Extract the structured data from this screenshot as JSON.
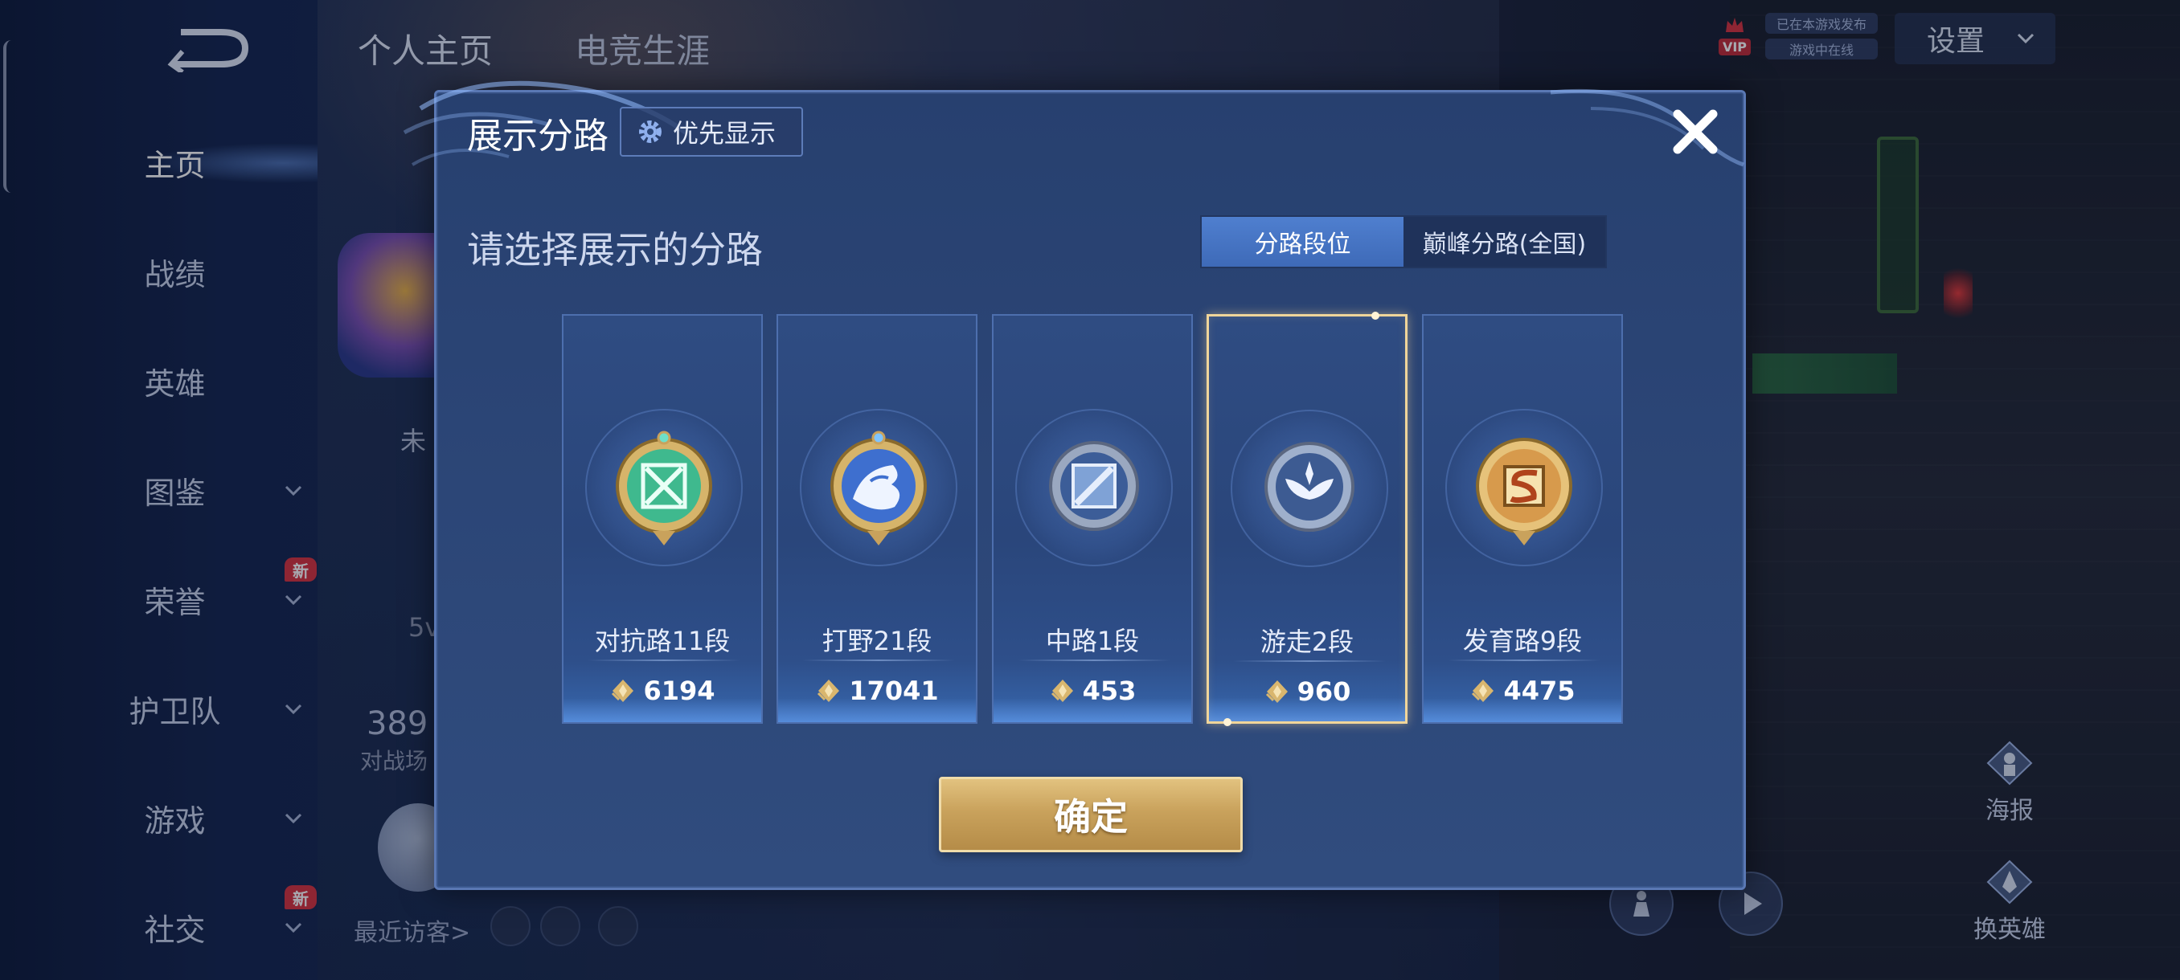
{
  "background": {
    "tabs": [
      "个人主页",
      "电竞生涯"
    ],
    "nav": [
      {
        "label": "主页",
        "active": true,
        "chevron": false,
        "new": false
      },
      {
        "label": "战绩",
        "active": false,
        "chevron": false,
        "new": false
      },
      {
        "label": "英雄",
        "active": false,
        "chevron": false,
        "new": false
      },
      {
        "label": "图鉴",
        "active": false,
        "chevron": true,
        "new": false
      },
      {
        "label": "荣誉",
        "active": false,
        "chevron": true,
        "new": true
      },
      {
        "label": "护卫队",
        "active": false,
        "chevron": true,
        "new": false
      },
      {
        "label": "游戏",
        "active": false,
        "chevron": true,
        "new": false
      },
      {
        "label": "社交",
        "active": false,
        "chevron": true,
        "new": true
      }
    ],
    "new_badge": "新",
    "peek_texts": [
      "未",
      "5v",
      "389",
      "对战场"
    ],
    "recent_visitors": "最近访客>",
    "vip_label": "VIP",
    "status_pills": [
      "已在本游戏发布",
      "游戏中在线"
    ],
    "settings_label": "设置",
    "poster_label": "海报",
    "change_hero_label": "换英雄"
  },
  "modal": {
    "title": "展示分路",
    "priority_label": "优先显示",
    "subtitle": "请选择展示的分路",
    "tabs": [
      {
        "label": "分路段位",
        "active": true
      },
      {
        "label": "巅峰分路(全国)",
        "active": false
      }
    ],
    "lanes": [
      {
        "name": "对抗路11段",
        "score": "6194",
        "selected": false,
        "emblem": "clash-lane-emblem-icon",
        "color": "#3fb98e"
      },
      {
        "name": "打野21段",
        "score": "17041",
        "selected": false,
        "emblem": "jungle-dragon-emblem-icon",
        "color": "#3e6fcf"
      },
      {
        "name": "中路1段",
        "score": "453",
        "selected": false,
        "emblem": "mid-lane-emblem-icon",
        "color": "#7fa2d6"
      },
      {
        "name": "游走2段",
        "score": "960",
        "selected": true,
        "emblem": "roam-wings-emblem-icon",
        "color": "#8fa4c8"
      },
      {
        "name": "发育路9段",
        "score": "4475",
        "selected": false,
        "emblem": "farm-lane-emblem-icon",
        "color": "#d79a4c"
      }
    ],
    "confirm_label": "确定"
  }
}
